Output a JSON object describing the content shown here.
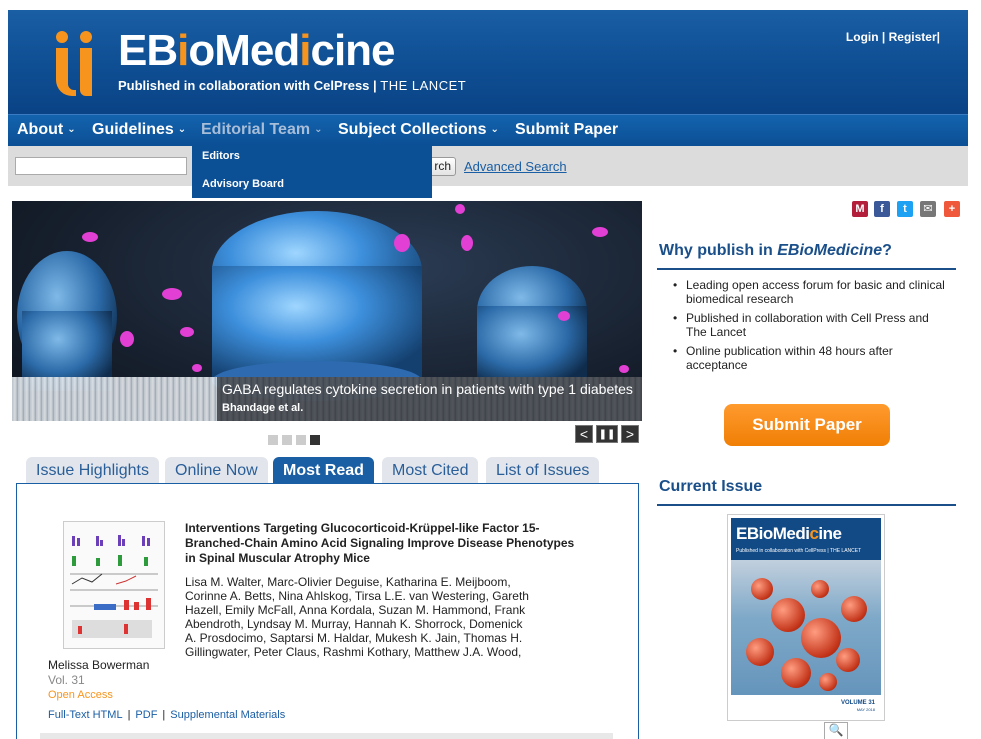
{
  "header": {
    "logo_prefix": "EB",
    "logo_o": "i",
    "logo_mid": "oMed",
    "logo_i": "i",
    "logo_suffix": "cine",
    "tagline_main": "Published in collaboration with",
    "tagline_cellpress": "CelPress",
    "tagline_sep": "|",
    "tagline_lancet": "THE LANCET",
    "login": "Login",
    "register": "Register",
    "sep1": "|",
    "sep2": "|"
  },
  "nav": {
    "items": [
      {
        "label": "About",
        "caret": "⌄"
      },
      {
        "label": "Guidelines",
        "caret": "⌄"
      },
      {
        "label": "Editorial Team",
        "caret": "⌄"
      },
      {
        "label": "Subject Collections",
        "caret": "⌄"
      },
      {
        "label": "Submit Paper",
        "caret": ""
      }
    ],
    "dropdown": [
      "Editors",
      "Advisory Board"
    ]
  },
  "search": {
    "placeholder": "",
    "button": "rch",
    "advanced": "Advanced Search"
  },
  "hero": {
    "title": "GABA regulates cytokine secretion in patients with type 1 diabetes",
    "subtitle": "Bhandage et al.",
    "slide_active": 4,
    "slide_count": 4,
    "prev": "<",
    "pause": "❚❚",
    "next": ">"
  },
  "tabs": [
    "Issue Highlights",
    "Online Now",
    "Most Read",
    "Most Cited",
    "List of Issues"
  ],
  "active_tab": "Most Read",
  "article": {
    "title": "Interventions Targeting Glucocorticoid-Krüppel-like Factor 15-Branched-Chain Amino Acid Signaling Improve Disease Phenotypes in Spinal Muscular Atrophy Mice",
    "authors": "Lisa M. Walter, Marc-Olivier Deguise, Katharina E. Meijboom, Corinne A. Betts, Nina Ahlskog, Tirsa L.E. van Westering, Gareth Hazell, Emily McFall, Anna Kordala, Suzan M. Hammond, Frank Abendroth, Lyndsay M. Murray, Hannah K. Shorrock, Domenick A. Prosdocimo, Saptarsi M. Haldar, Mukesh K. Jain, Thomas H. Gillingwater, Peter Claus, Rashmi Kothary, Matthew J.A. Wood,",
    "last_author": "Melissa Bowerman",
    "volume": "Vol. 31",
    "access": "Open Access",
    "links": [
      "Full-Text HTML",
      "PDF",
      "Supplemental Materials"
    ],
    "link_sep": "|"
  },
  "sidebar": {
    "share_icons": [
      "mendeley-icon",
      "facebook-icon",
      "twitter-icon",
      "email-icon",
      "plus-icon"
    ],
    "share_glyphs": [
      "M",
      "f",
      "t",
      "✉",
      "+"
    ],
    "why_prefix": "Why publish in ",
    "why_journal": "EBioMedicine",
    "why_suffix": "?",
    "why_points": [
      "Leading open access forum for basic and clinical biomedical research",
      "Published in collaboration with Cell Press and The Lancet",
      "Online publication within 48 hours after acceptance"
    ],
    "submit": "Submit Paper",
    "current_issue": "Current Issue",
    "cover_logo_a": "EBioMedi",
    "cover_logo_b": "c",
    "cover_logo_c": "ine",
    "cover_tagline": "Published in collaboration with CellPress | THE LANCET",
    "cover_volume": "VOLUME 31",
    "cover_date": "MAY 2018",
    "zoom": "🔍"
  },
  "colors": {
    "brand_blue": "#0f4f94",
    "accent_orange": "#f7941d",
    "link_blue": "#1a5ea4"
  }
}
